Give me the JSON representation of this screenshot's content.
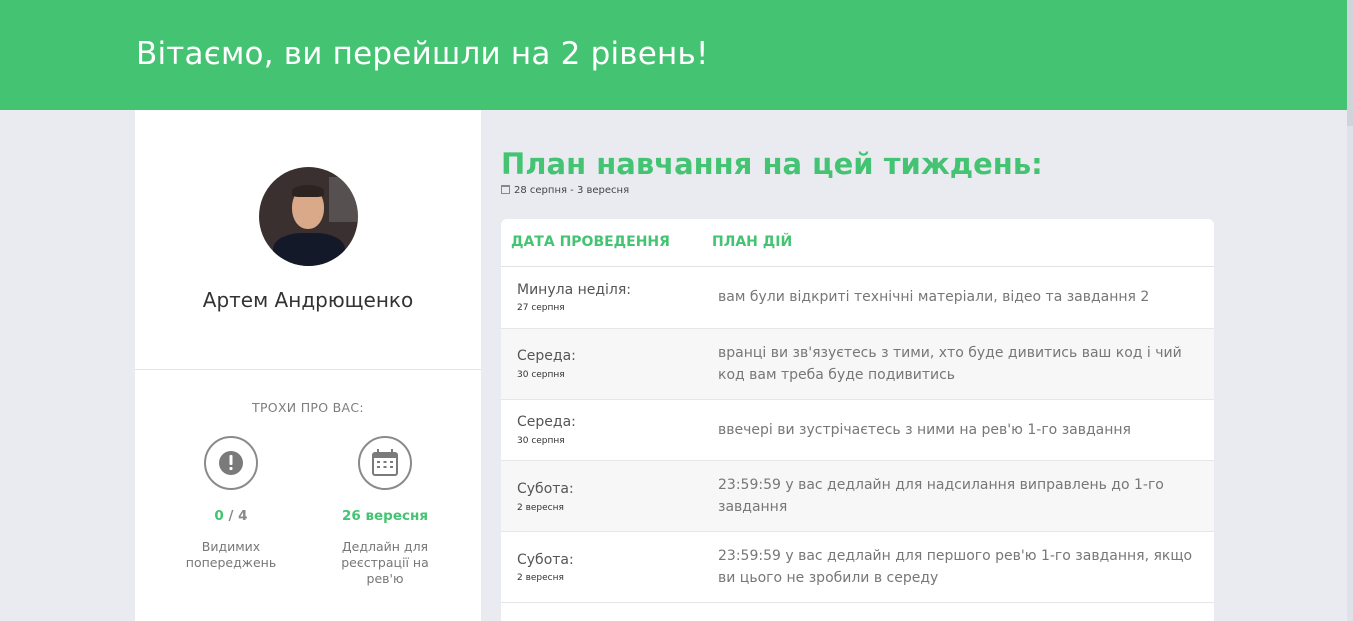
{
  "header": {
    "title": "Вітаємо, ви перейшли на 2 рівень!"
  },
  "profile": {
    "name": "Артем Андрющенко",
    "about_label": "ТРОХИ ПРО ВАС:",
    "stats": [
      {
        "icon": "exclamation-icon",
        "value": "0",
        "value_suffix": " / 4",
        "label": "Видимих попереджень"
      },
      {
        "icon": "calendar-icon",
        "value": "26 вересня",
        "label": "Дедлайн для реєстрації на рев'ю"
      }
    ]
  },
  "plan": {
    "title": "План навчання на цей тиждень:",
    "date_range": "28 серпня - 3 вересня",
    "columns": [
      "ДАТА ПРОВЕДЕННЯ",
      "ПЛАН ДІЙ"
    ],
    "rows": [
      {
        "day": "Минула неділя:",
        "date": "27 серпня",
        "text": "вам були відкриті технічні матеріали, відео та завдання 2"
      },
      {
        "day": "Середа:",
        "date": "30 серпня",
        "text": "вранці ви зв'язуєтесь з тими, хто буде дивитись ваш код і чий код вам треба буде подивитись"
      },
      {
        "day": "Середа:",
        "date": "30 серпня",
        "text": "ввечері ви зустрічаєтесь з ними на рев'ю 1-го завдання"
      },
      {
        "day": "Субота:",
        "date": "2 вересня",
        "text": "23:59:59 у вас дедлайн для надсилання виправлень до 1-го завдання"
      },
      {
        "day": "Субота:",
        "date": "2 вересня",
        "text": "23:59:59 у вас дедлайн для першого рев'ю 1-го завдання, якщо ви цього не зробили в середу"
      }
    ]
  },
  "colors": {
    "accent": "#44c472",
    "background": "#e9ebf1"
  }
}
